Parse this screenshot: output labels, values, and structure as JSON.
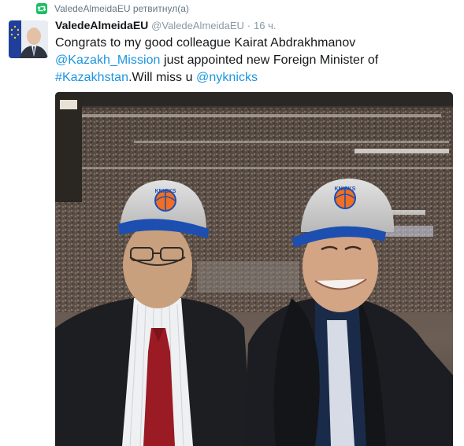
{
  "retweet": {
    "icon": "retweet-icon",
    "user": "ValedeAlmeidaEU",
    "action": "ретвитнул(а)"
  },
  "tweet": {
    "avatar": "eu-flag-portrait-avatar",
    "display_name": "ValedeAlmeidaEU",
    "handle": "@ValedeAlmeidaEU",
    "separator": "·",
    "time": "16 ч.",
    "text": {
      "line1": "Congrats to my good colleague Kairat Abdrakhmanov",
      "mention1": "@Kazakh_Mission",
      "line2_rest": " just appointed new Foreign Minister of",
      "hashtag": "#Kazakhstan",
      "line3_rest": ".Will miss  u ",
      "mention2": "@nyknicks"
    },
    "photo": {
      "description_icon": "arena-photo",
      "cap_logo_text": "KNICKS"
    }
  },
  "colors": {
    "link": "#1b95e0",
    "retweet_green": "#17bf63",
    "meta_gray": "#8899a6"
  }
}
